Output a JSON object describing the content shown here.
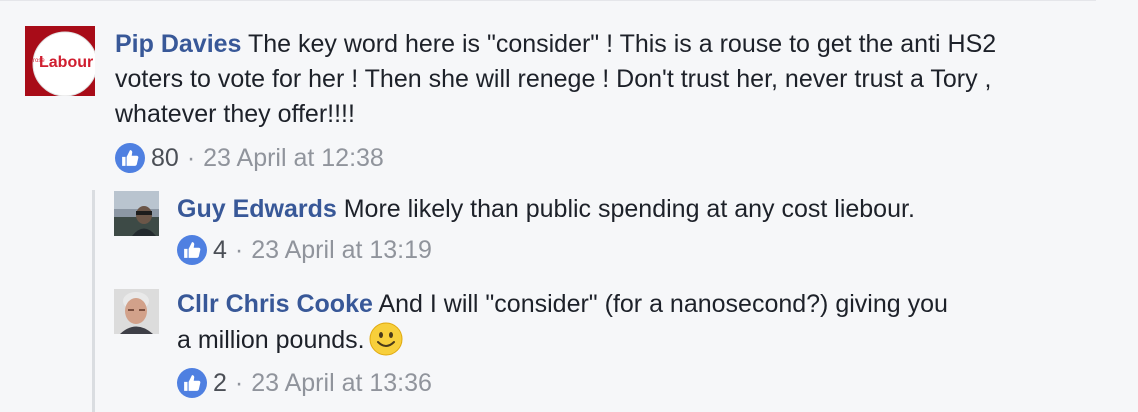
{
  "comments": [
    {
      "author": "Pip Davies",
      "text_line1": "The key word here is \"consider\" ! This is a rouse to get the anti HS2",
      "text_line2": "voters to vote for her ! Then she will renege ! Don't trust her, never trust a Tory ,",
      "text_line3": "whatever they offer!!!!",
      "likes": "80",
      "timestamp": "23 April at 12:38",
      "avatar_text": "Labour",
      "avatar_colors": {
        "bg": "#b40f1d",
        "badge": "#ffffff",
        "text": "#d01e2f"
      }
    }
  ],
  "replies": [
    {
      "author": "Guy Edwards",
      "text_line1": "More likely than public spending at any cost liebour.",
      "likes": "4",
      "timestamp": "23 April at 13:19"
    },
    {
      "author": "Cllr Chris Cooke",
      "text_line1": "And I will \"consider\" (for a nanosecond?) giving you",
      "text_line2": "a million pounds.",
      "likes": "2",
      "timestamp": "23 April at 13:36"
    }
  ],
  "separator": "·",
  "colors": {
    "link": "#385898",
    "meta": "#90949c",
    "like_badge": "#4f80e1",
    "background": "#f6f7f9"
  }
}
